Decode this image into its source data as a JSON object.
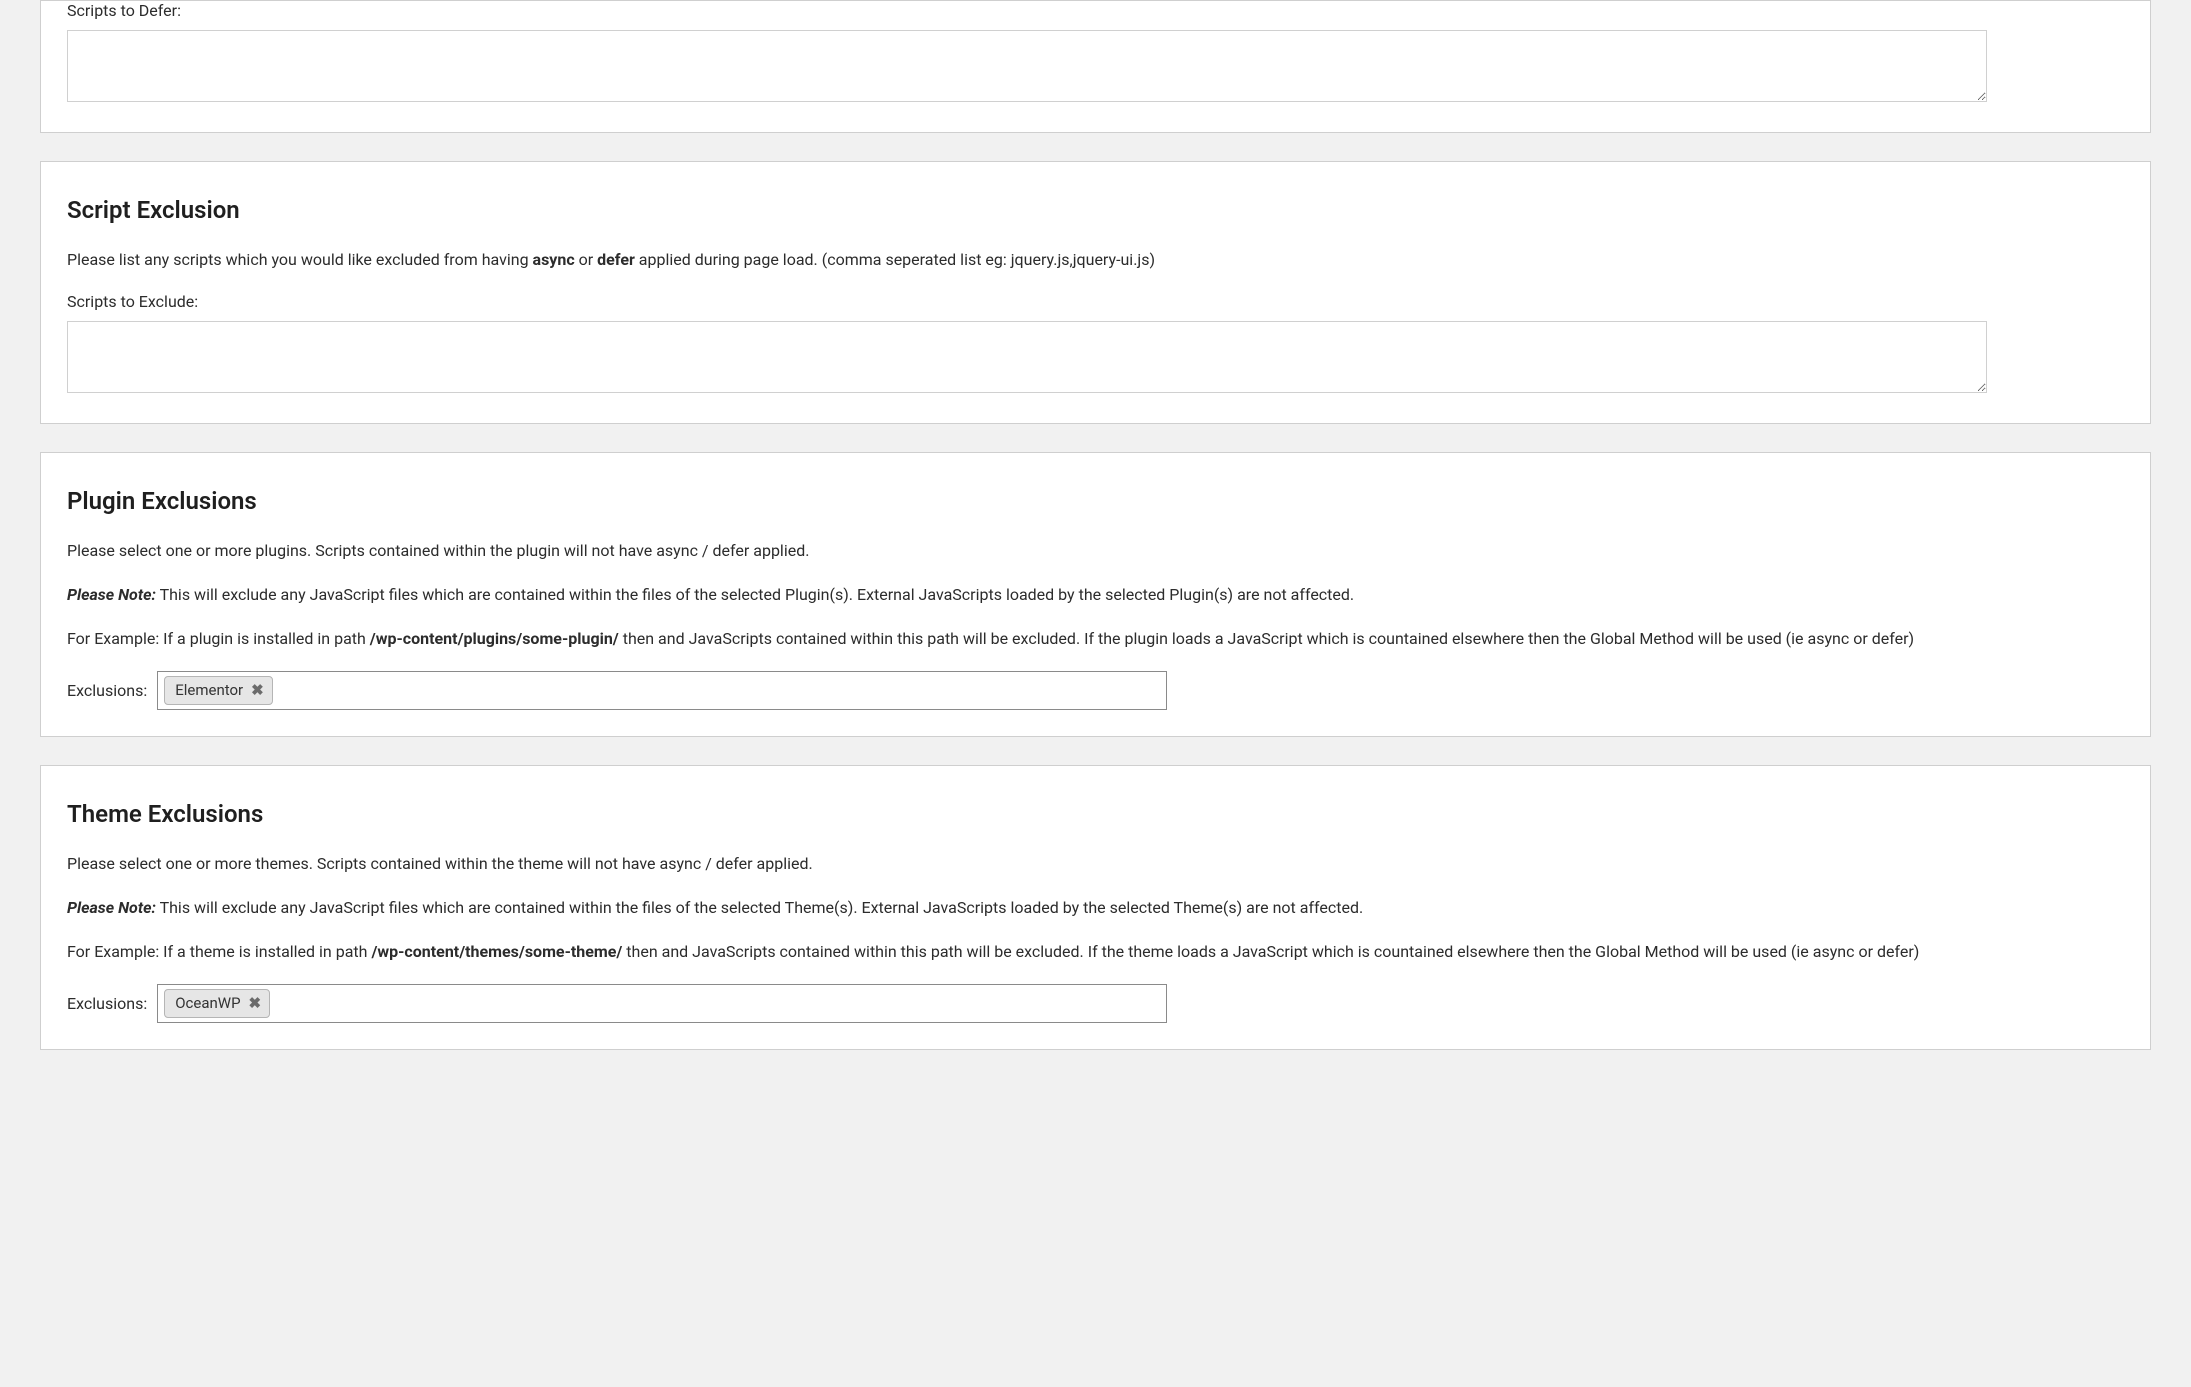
{
  "defer": {
    "label": "Scripts to Defer:",
    "value": ""
  },
  "script_exclusion": {
    "title": "Script Exclusion",
    "desc_prefix": "Please list any scripts which you would like excluded from having ",
    "desc_bold1": "async",
    "desc_mid": " or ",
    "desc_bold2": "defer",
    "desc_suffix": " applied during page load. (comma seperated list eg: jquery.js,jquery-ui.js)",
    "label": "Scripts to Exclude:",
    "value": ""
  },
  "plugin_exclusions": {
    "title": "Plugin Exclusions",
    "p1": "Please select one or more plugins. Scripts contained within the plugin will not have async / defer applied.",
    "note_label": "Please Note:",
    "note_text": " This will exclude any JavaScript files which are contained within the files of the selected Plugin(s). External JavaScripts loaded by the selected Plugin(s) are not affected.",
    "ex_prefix": "For Example: If a plugin is installed in path ",
    "ex_bold": "/wp-content/plugins/some-plugin/",
    "ex_suffix": " then and JavaScripts contained within this path will be excluded. If the plugin loads a JavaScript which is countained elsewhere then the Global Method will be used (ie async or defer)",
    "select_label": "Exclusions:",
    "chips": [
      "Elementor"
    ]
  },
  "theme_exclusions": {
    "title": "Theme Exclusions",
    "p1": "Please select one or more themes. Scripts contained within the theme will not have async / defer applied.",
    "note_label": "Please Note:",
    "note_text": " This will exclude any JavaScript files which are contained within the files of the selected Theme(s). External JavaScripts loaded by the selected Theme(s) are not affected.",
    "ex_prefix": "For Example: If a theme is installed in path ",
    "ex_bold": "/wp-content/themes/some-theme/",
    "ex_suffix": " then and JavaScripts contained within this path will be excluded. If the theme loads a JavaScript which is countained elsewhere then the Global Method will be used (ie async or defer)",
    "select_label": "Exclusions:",
    "chips": [
      "OceanWP"
    ]
  },
  "icons": {
    "close": "✖"
  }
}
